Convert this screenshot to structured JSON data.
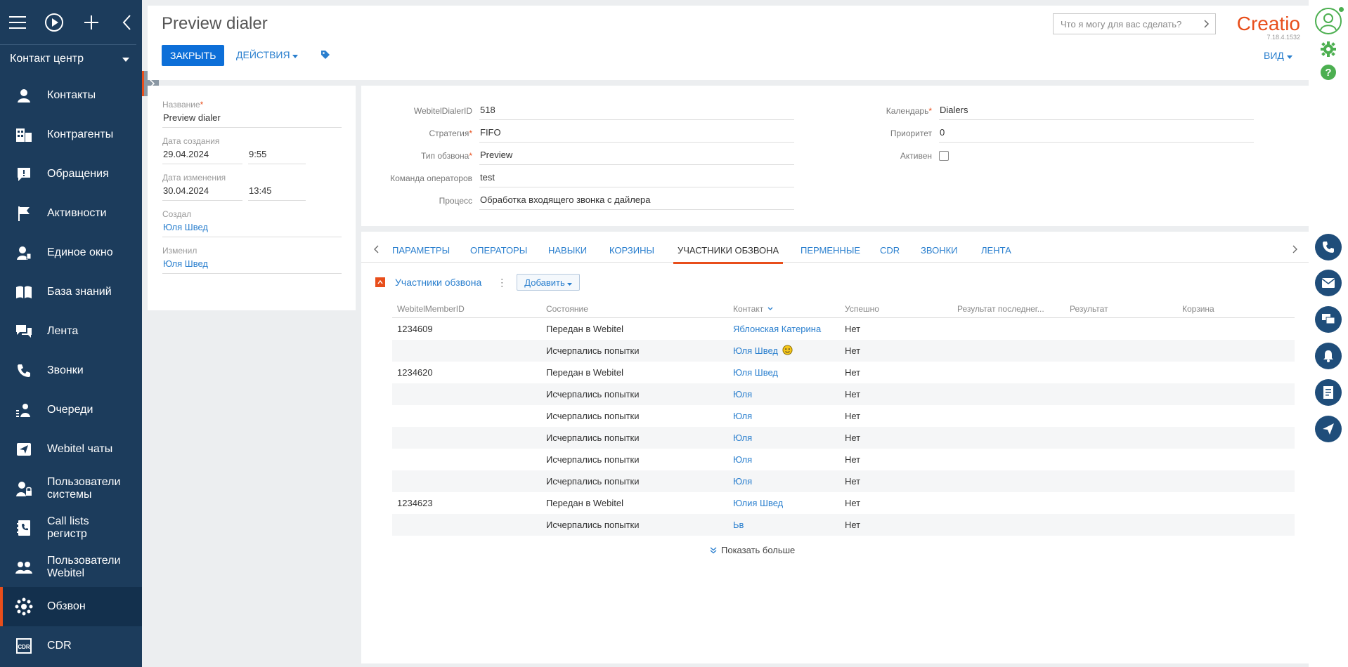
{
  "sidebar": {
    "workplace": "Контакт центр",
    "items": [
      {
        "label": "Контакты",
        "icon": "person-icon"
      },
      {
        "label": "Контрагенты",
        "icon": "building-icon"
      },
      {
        "label": "Обращения",
        "icon": "alert-icon"
      },
      {
        "label": "Активности",
        "icon": "flag-icon"
      },
      {
        "label": "Единое окно",
        "icon": "person-window-icon"
      },
      {
        "label": "База знаний",
        "icon": "book-icon"
      },
      {
        "label": "Лента",
        "icon": "chat-icon"
      },
      {
        "label": "Звонки",
        "icon": "phone-icon"
      },
      {
        "label": "Очереди",
        "icon": "queue-icon"
      },
      {
        "label": "Webitel чаты",
        "icon": "send-icon"
      },
      {
        "label": "Пользователи системы",
        "icon": "user-lock-icon"
      },
      {
        "label": "Call lists регистр",
        "icon": "phone-book-icon"
      },
      {
        "label": "Пользователи Webitel",
        "icon": "users-icon"
      },
      {
        "label": "Обзвон",
        "icon": "dialer-icon",
        "active": true
      },
      {
        "label": "CDR",
        "icon": "cdr-icon"
      }
    ]
  },
  "header": {
    "title": "Preview dialer",
    "close_label": "ЗАКРЫТЬ",
    "actions_label": "ДЕЙСТВИЯ",
    "search_placeholder": "Что я могу для вас сделать?",
    "brand": "Creatio",
    "version": "7.18.4.1532",
    "view_label": "ВИД"
  },
  "left_panel": {
    "name_label": "Название",
    "name_value": "Preview dialer",
    "created_label": "Дата создания",
    "created_date": "29.04.2024",
    "created_time": "9:55",
    "modified_label": "Дата изменения",
    "modified_date": "30.04.2024",
    "modified_time": "13:45",
    "created_by_label": "Создал",
    "created_by": "Юля Швед",
    "modified_by_label": "Изменил",
    "modified_by": "Юля Швед"
  },
  "details": {
    "dialer_id_label": "WebitelDialerID",
    "dialer_id": "518",
    "strategy_label": "Стратегия",
    "strategy": "FIFO",
    "type_label": "Тип обзвона",
    "type": "Preview",
    "team_label": "Команда операторов",
    "team": "test",
    "process_label": "Процесс",
    "process": "Обработка входящего звонка с дайлера",
    "calendar_label": "Календарь",
    "calendar": "Dialers",
    "priority_label": "Приоритет",
    "priority": "0",
    "active_label": "Активен"
  },
  "tabs": [
    "ПАРАМЕТРЫ",
    "ОПЕРАТОРЫ",
    "НАВЫКИ",
    "КОРЗИНЫ",
    "УЧАСТНИКИ ОБЗВОНА",
    "ПЕРМЕННЫЕ",
    "CDR",
    "ЗВОНКИ",
    "ЛЕНТА"
  ],
  "members": {
    "title": "Участники обзвона",
    "add_label": "Добавить",
    "columns": [
      "WebitelMemberID",
      "Состояние",
      "Контакт",
      "Успешно",
      "Результат последнег...",
      "Результат",
      "Корзина"
    ],
    "rows": [
      {
        "id": "1234609",
        "state": "Передан в Webitel",
        "contact": "Яблонская Катерина",
        "success": "Нет"
      },
      {
        "id": "",
        "state": "Исчерпались попытки",
        "contact": "Юля Швед",
        "success": "Нет",
        "smiley": true
      },
      {
        "id": "1234620",
        "state": "Передан в Webitel",
        "contact": "Юля Швед",
        "success": "Нет"
      },
      {
        "id": "",
        "state": "Исчерпались попытки",
        "contact": "Юля",
        "success": "Нет"
      },
      {
        "id": "",
        "state": "Исчерпались попытки",
        "contact": "Юля",
        "success": "Нет"
      },
      {
        "id": "",
        "state": "Исчерпались попытки",
        "contact": "Юля",
        "success": "Нет"
      },
      {
        "id": "",
        "state": "Исчерпались попытки",
        "contact": "Юля",
        "success": "Нет"
      },
      {
        "id": "",
        "state": "Исчерпались попытки",
        "contact": "Юля",
        "success": "Нет"
      },
      {
        "id": "1234623",
        "state": "Передан в Webitel",
        "contact": "Юлия Швед",
        "success": "Нет"
      },
      {
        "id": "",
        "state": "Исчерпались попытки",
        "contact": "Ьв",
        "success": "Нет"
      }
    ],
    "show_more": "Показать больше"
  },
  "colors": {
    "sidebar": "#1c3c5c",
    "accent": "#e84e1b",
    "primary": "#0d6fd8",
    "link": "#2a7fce"
  }
}
